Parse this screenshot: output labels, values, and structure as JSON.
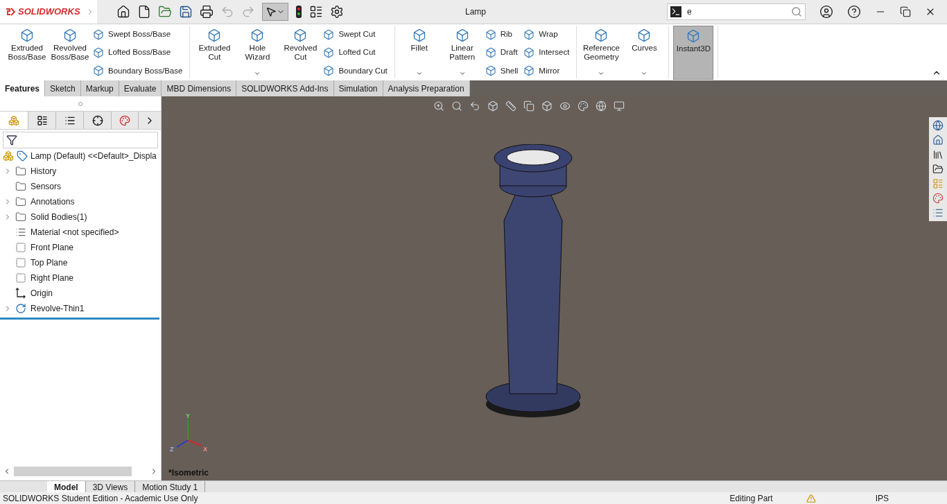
{
  "app": {
    "logo": "SOLIDWORKS"
  },
  "window": {
    "title": "Lamp"
  },
  "search": {
    "value": "e"
  },
  "ribbon": {
    "groups": [
      {
        "items": [
          {
            "kind": "large",
            "label": "Extruded Boss/Base",
            "dropdown": false
          },
          {
            "kind": "large",
            "label": "Revolved Boss/Base",
            "dropdown": false
          },
          {
            "kind": "stack",
            "entries": [
              "Swept Boss/Base",
              "Lofted Boss/Base",
              "Boundary Boss/Base"
            ]
          }
        ]
      },
      {
        "items": [
          {
            "kind": "large",
            "label": "Extruded Cut",
            "dropdown": false
          },
          {
            "kind": "large",
            "label": "Hole Wizard",
            "dropdown": true
          },
          {
            "kind": "large",
            "label": "Revolved Cut",
            "dropdown": false
          },
          {
            "kind": "stack",
            "entries": [
              "Swept Cut",
              "Lofted Cut",
              "Boundary Cut"
            ]
          }
        ]
      },
      {
        "items": [
          {
            "kind": "large",
            "label": "Fillet",
            "dropdown": true
          },
          {
            "kind": "large",
            "label": "Linear Pattern",
            "dropdown": true
          },
          {
            "kind": "stack",
            "entries": [
              "Rib",
              "Draft",
              "Shell"
            ]
          },
          {
            "kind": "stack",
            "entries": [
              "Wrap",
              "Intersect",
              "Mirror"
            ]
          }
        ]
      },
      {
        "items": [
          {
            "kind": "large",
            "label": "Reference Geometry",
            "dropdown": true
          },
          {
            "kind": "large",
            "label": "Curves",
            "dropdown": true
          }
        ]
      },
      {
        "items": [
          {
            "kind": "large",
            "label": "Instant3D",
            "dropdown": false,
            "selected": true
          }
        ]
      }
    ]
  },
  "tabs": [
    {
      "label": "Features",
      "selected": true
    },
    {
      "label": "Sketch",
      "selected": false
    },
    {
      "label": "Markup",
      "selected": false
    },
    {
      "label": "Evaluate",
      "selected": false
    },
    {
      "label": "MBD Dimensions",
      "selected": false
    },
    {
      "label": "SOLIDWORKS Add-Ins",
      "selected": false
    },
    {
      "label": "Simulation",
      "selected": false
    },
    {
      "label": "Analysis Preparation",
      "selected": false
    }
  ],
  "tree": {
    "root": "Lamp (Default) <<Default>_Displa",
    "items": [
      {
        "kind": "folder",
        "label": "History",
        "expandable": true
      },
      {
        "kind": "folder",
        "label": "Sensors",
        "expandable": false
      },
      {
        "kind": "folder",
        "label": "Annotations",
        "expandable": true
      },
      {
        "kind": "folder",
        "label": "Solid Bodies(1)",
        "expandable": true
      },
      {
        "kind": "material",
        "label": "Material <not specified>",
        "expandable": false
      },
      {
        "kind": "plane",
        "label": "Front Plane",
        "expandable": false
      },
      {
        "kind": "plane",
        "label": "Top Plane",
        "expandable": false
      },
      {
        "kind": "plane",
        "label": "Right Plane",
        "expandable": false
      },
      {
        "kind": "origin",
        "label": "Origin",
        "expandable": false
      },
      {
        "kind": "feature",
        "label": "Revolve-Thin1",
        "expandable": true
      }
    ]
  },
  "view": {
    "label": "*Isometric",
    "triad": {
      "x": "X",
      "y": "Y",
      "z": "Z"
    }
  },
  "bottom_tabs": [
    {
      "label": "Model",
      "selected": true
    },
    {
      "label": "3D Views",
      "selected": false
    },
    {
      "label": "Motion Study 1",
      "selected": false
    }
  ],
  "status_bar": {
    "text": "SOLIDWORKS Student Edition - Academic Use Only",
    "mode": "Editing Part",
    "units": "IPS"
  }
}
